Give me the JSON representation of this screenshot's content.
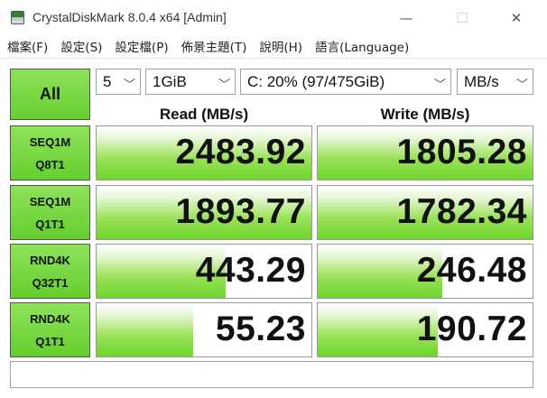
{
  "window": {
    "title": "CrystalDiskMark 8.0.4 x64 [Admin]",
    "minimize": "—",
    "maximize": "☐",
    "close": "✕"
  },
  "menu": [
    "檔案(F)",
    "設定(S)",
    "設定檔(P)",
    "佈景主題(T)",
    "說明(H)",
    "語言(Language)"
  ],
  "controls": {
    "all_label": "All",
    "count": "5",
    "size": "1GiB",
    "drive": "C: 20% (97/475GiB)",
    "unit": "MB/s",
    "chevron": "﹀"
  },
  "headers": {
    "read": "Read (MB/s)",
    "write": "Write (MB/s)"
  },
  "rows": [
    {
      "line1": "SEQ1M",
      "line2": "Q8T1",
      "read": "2483.92",
      "write": "1805.28",
      "read_fill": 1.0,
      "write_fill": 1.0
    },
    {
      "line1": "SEQ1M",
      "line2": "Q1T1",
      "read": "1893.77",
      "write": "1782.34",
      "read_fill": 1.0,
      "write_fill": 1.0
    },
    {
      "line1": "RND4K",
      "line2": "Q32T1",
      "read": "443.29",
      "write": "246.48",
      "read_fill": 0.6,
      "write_fill": 0.58
    },
    {
      "line1": "RND4K",
      "line2": "Q1T1",
      "read": "55.23",
      "write": "190.72",
      "read_fill": 0.45,
      "write_fill": 0.56
    }
  ],
  "comment": ""
}
